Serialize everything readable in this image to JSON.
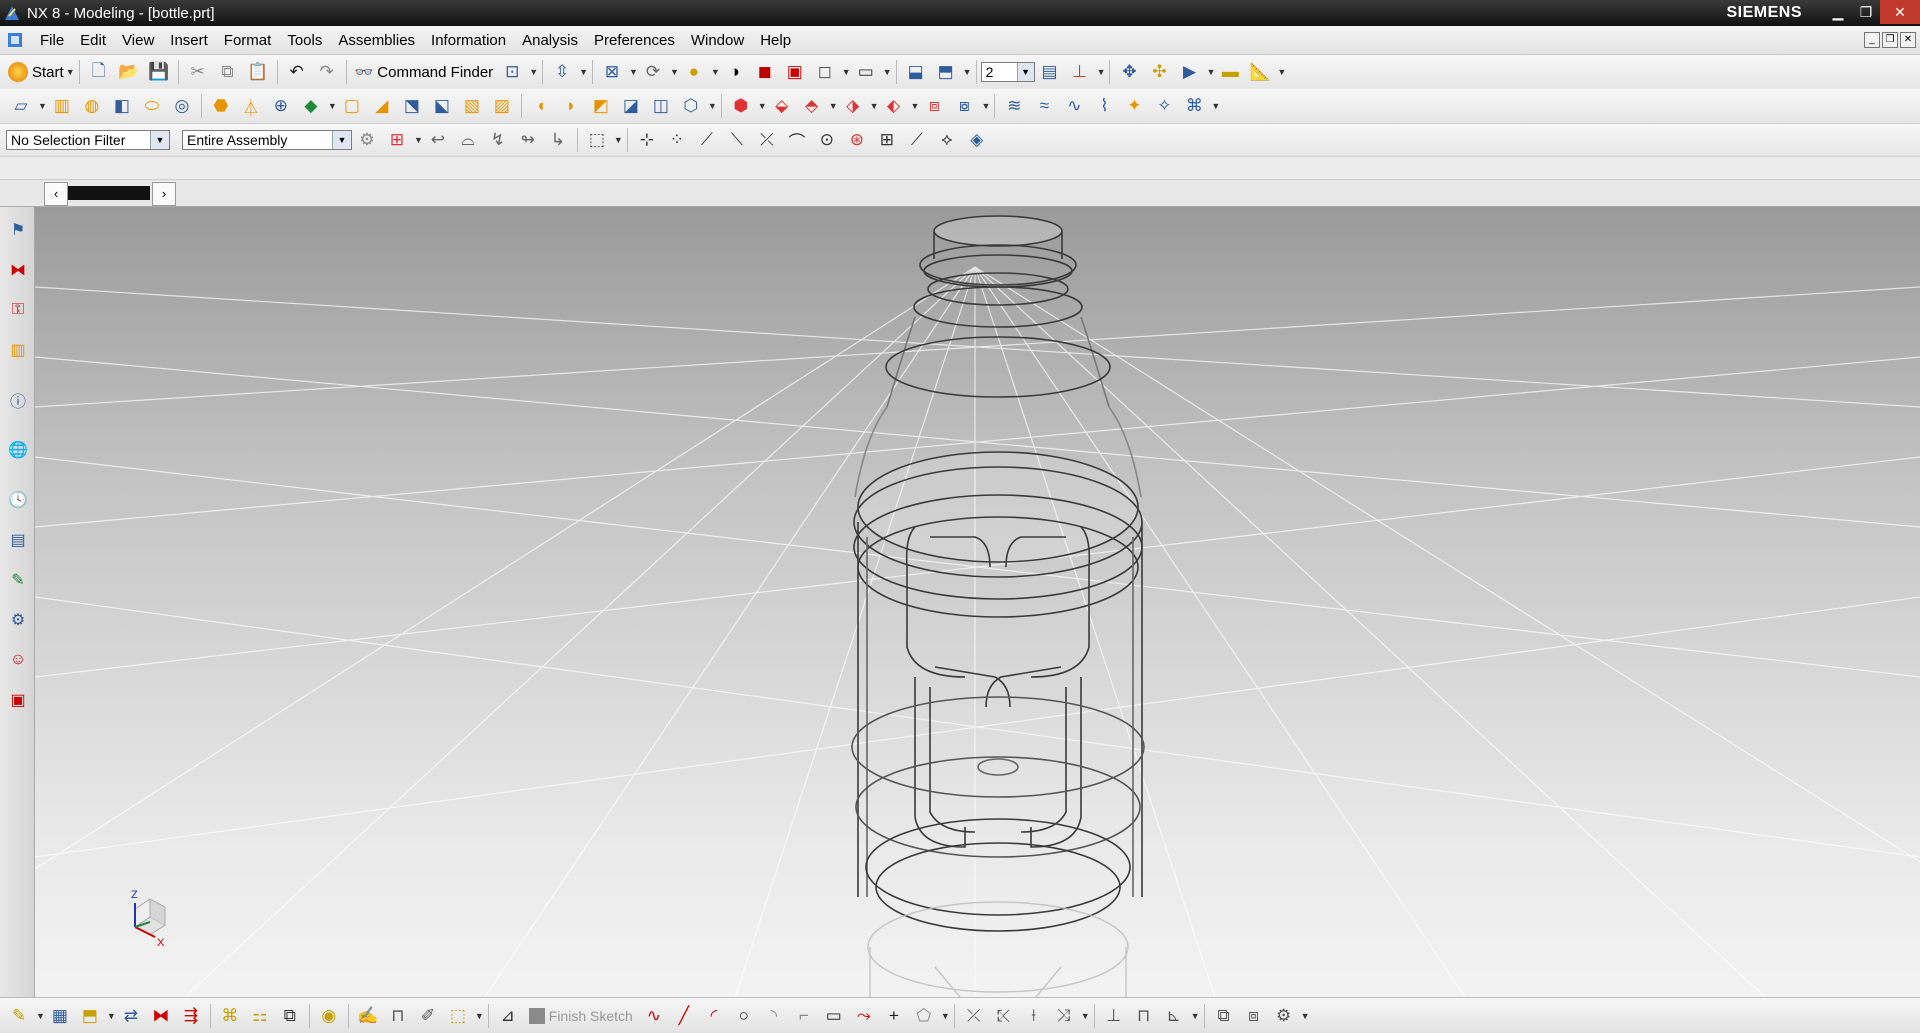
{
  "window": {
    "title": "NX 8 - Modeling - [bottle.prt]",
    "brand": "SIEMENS"
  },
  "menu": {
    "items": [
      "File",
      "Edit",
      "View",
      "Insert",
      "Format",
      "Tools",
      "Assemblies",
      "Information",
      "Analysis",
      "Preferences",
      "Window",
      "Help"
    ]
  },
  "toolbar": {
    "start_label": "Start",
    "command_finder_label": "Command Finder",
    "layer_value": "2"
  },
  "selection": {
    "filter_value": "No Selection Filter",
    "scope_value": "Entire Assembly"
  },
  "sketch": {
    "finish_label": "Finish Sketch"
  },
  "triad": {
    "z_label": "Z",
    "x_label": "X"
  },
  "colors": {
    "accent": "#2f5c9b",
    "close": "#c0392b"
  }
}
